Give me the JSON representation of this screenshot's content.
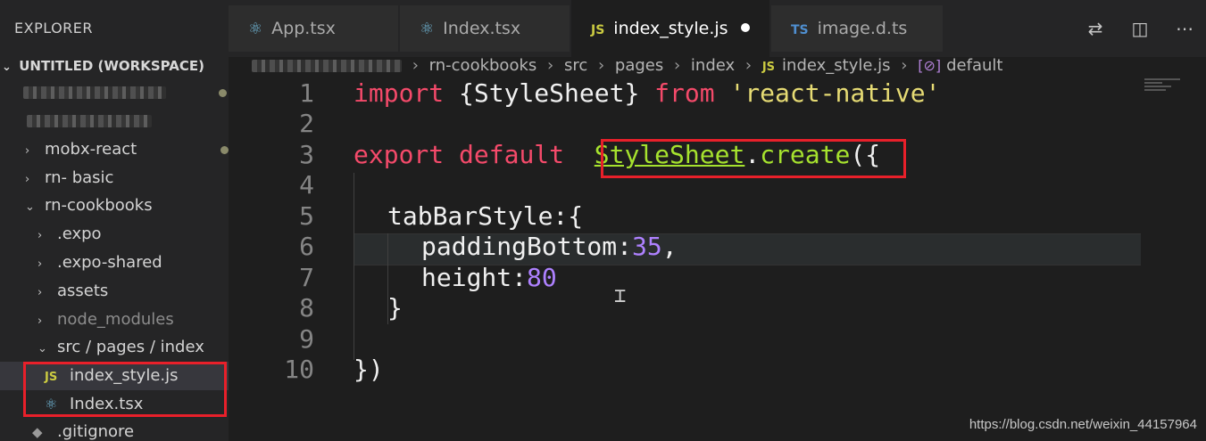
{
  "sidebar": {
    "title": "EXPLORER",
    "workspace": "UNTITLED (WORKSPACE)",
    "items": [
      {
        "label": "mobx-react"
      },
      {
        "label": "rn- basic"
      },
      {
        "label": "rn-cookbooks"
      },
      {
        "label": ".expo"
      },
      {
        "label": ".expo-shared"
      },
      {
        "label": "assets"
      },
      {
        "label": "node_modules"
      },
      {
        "label": "src / pages / index"
      },
      {
        "label": "index_style.js"
      },
      {
        "label": "Index.tsx"
      },
      {
        "label": ".gitignore"
      }
    ]
  },
  "tabs": [
    {
      "label": "App.tsx",
      "icon": "react-icon"
    },
    {
      "label": "Index.tsx",
      "icon": "react-icon"
    },
    {
      "label": "index_style.js",
      "icon": "js-icon",
      "modified": true
    },
    {
      "label": "image.d.ts",
      "icon": "ts-icon"
    }
  ],
  "breadcrumb": {
    "parts": [
      "rn-cookbooks",
      "src",
      "pages",
      "index",
      "index_style.js",
      "default"
    ]
  },
  "editor": {
    "line_numbers": [
      "1",
      "2",
      "3",
      "4",
      "5",
      "6",
      "7",
      "8",
      "9",
      "10"
    ],
    "tokens": {
      "l1_import": "import",
      "l1_brace": " {StyleSheet} ",
      "l1_from": "from",
      "l1_str": "'react-native'",
      "l3_export": "export",
      "l3_default": "default",
      "l3_stylesheet": "StyleSheet",
      "l3_dot": ".",
      "l3_create": "create",
      "l3_paren": "({",
      "l5": "tabBarStyle:{",
      "l6_key": "paddingBottom:",
      "l6_val": "35",
      "l6_comma": ",",
      "l7_key": "height:",
      "l7_val": "80",
      "l8": "}",
      "l10": "})"
    }
  },
  "watermark": "https://blog.csdn.net/weixin_44157964",
  "colors": {
    "highlight_box": "#e8202a",
    "keyword": "#f44a6a",
    "string": "#e6db74",
    "function": "#a6e22e",
    "number": "#ae81ff"
  }
}
